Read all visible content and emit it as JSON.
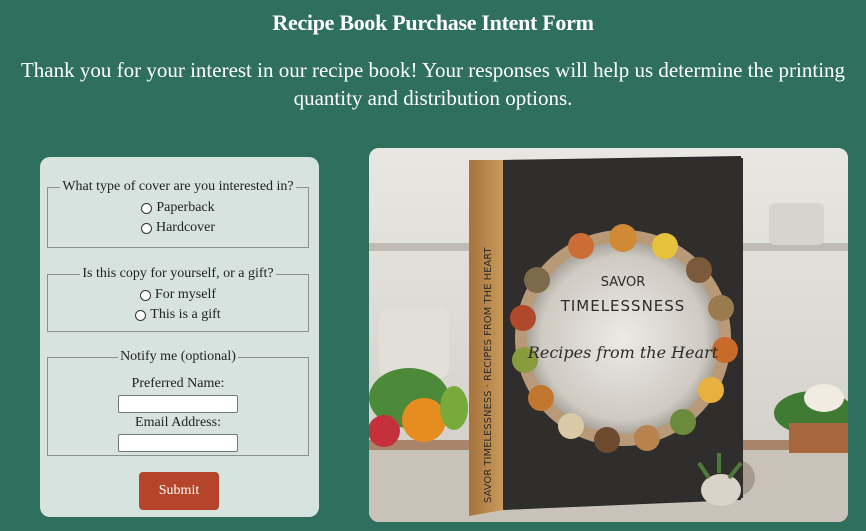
{
  "page": {
    "title": "Recipe Book Purchase Intent Form",
    "intro": "Thank you for your interest in our recipe book! Your responses will help us determine the printing quantity and distribution options."
  },
  "form": {
    "cover": {
      "legend": "What type of cover are you interested in?",
      "options": [
        "Paperback",
        "Hardcover"
      ]
    },
    "recipient": {
      "legend": "Is this copy for yourself, or a gift?",
      "options": [
        "For myself",
        "This is a gift"
      ]
    },
    "notify": {
      "legend": "Notify me (optional)",
      "name_label": "Preferred Name:",
      "email_label": "Email Address:",
      "name_value": "",
      "email_value": ""
    },
    "submit_label": "Submit"
  },
  "book": {
    "title_top": "SAVOR",
    "title_main": "TIMELESSNESS",
    "subtitle": "Recipes from the Heart",
    "spine": "SAVOR TIMELESSNESS · RECIPES FROM THE HEART"
  },
  "colors": {
    "background": "#2f6f5e",
    "panel": "#d6e3df",
    "accent": "#b5452a"
  }
}
